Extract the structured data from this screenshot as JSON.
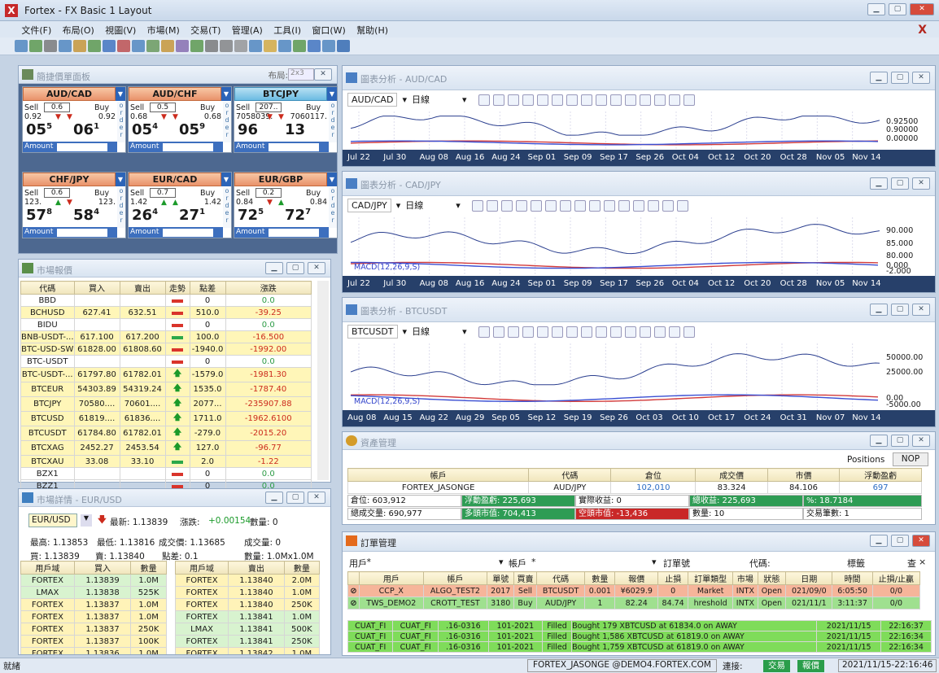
{
  "window": {
    "title": "Fortex - FX Basic 1 Layout"
  },
  "menu": [
    "文件(F)",
    "布局(O)",
    "視圖(V)",
    "市場(M)",
    "交易(T)",
    "管理(A)",
    "工具(I)",
    "窗口(W)",
    "幫助(H)"
  ],
  "quick_trade": {
    "title": "簡捷價單面板",
    "layout_label": "布局:",
    "layout_value": "2x3",
    "tiles": [
      {
        "pair": "AUD/CAD",
        "color": "orange",
        "spread": "0.6",
        "sell_label": "Sell",
        "buy_label": "Buy",
        "sell_small": "0.92",
        "buy_small": "0.92",
        "sell_big": "05",
        "sell_sup": "5",
        "buy_big": "06",
        "buy_sup": "1",
        "dir": "down",
        "amount_label": "Amount"
      },
      {
        "pair": "AUD/CHF",
        "color": "orange",
        "spread": "0.5",
        "sell_label": "Sell",
        "buy_label": "Buy",
        "sell_small": "0.68",
        "buy_small": "0.68",
        "sell_big": "05",
        "sell_sup": "4",
        "buy_big": "05",
        "buy_sup": "9",
        "dir": "down",
        "amount_label": "Amount"
      },
      {
        "pair": "BTCJPY",
        "color": "blue",
        "spread": "207..",
        "sell_label": "Sell",
        "buy_label": "Buy",
        "sell_small": "7058039.",
        "buy_small": "7060117.",
        "sell_big": "96",
        "sell_sup": "",
        "buy_big": "13",
        "buy_sup": "",
        "dir": "down",
        "amount_label": "Amount"
      },
      {
        "pair": "CHF/JPY",
        "color": "orange",
        "spread": "0.6",
        "sell_label": "Sell",
        "buy_label": "Buy",
        "sell_small": "123.",
        "buy_small": "123.",
        "sell_big": "57",
        "sell_sup": "8",
        "buy_big": "58",
        "buy_sup": "4",
        "dir": "updown",
        "amount_label": "Amount"
      },
      {
        "pair": "EUR/CAD",
        "color": "orange",
        "spread": "0.7",
        "sell_label": "Sell",
        "buy_label": "Buy",
        "sell_small": "1.42",
        "buy_small": "1.42",
        "sell_big": "26",
        "sell_sup": "4",
        "buy_big": "27",
        "buy_sup": "1",
        "dir": "up",
        "amount_label": "Amount"
      },
      {
        "pair": "EUR/GBP",
        "color": "orange",
        "spread": "0.2",
        "sell_label": "Sell",
        "buy_label": "Buy",
        "sell_small": "0.84",
        "buy_small": "0.84",
        "sell_big": "72",
        "sell_sup": "5",
        "buy_big": "72",
        "buy_sup": "7",
        "dir": "downup",
        "amount_label": "Amount"
      }
    ],
    "order_label": "order"
  },
  "market_quotes": {
    "title": "市場報價",
    "headers": [
      "代碼",
      "買入",
      "賣出",
      "走勢",
      "點差",
      "漲跌"
    ],
    "rows": [
      {
        "code": "BBD",
        "bid": "",
        "ask": "",
        "trend": "flat",
        "spread": "0",
        "change": "0.0",
        "hl": false
      },
      {
        "code": "BCHUSD",
        "bid": "627.41",
        "ask": "632.51",
        "trend": "flat",
        "spread": "510.0",
        "change": "-39.25",
        "hl": true
      },
      {
        "code": "BIDU",
        "bid": "",
        "ask": "",
        "trend": "flat",
        "spread": "0",
        "change": "0.0",
        "hl": false
      },
      {
        "code": "BNB-USDT-...",
        "bid": "617.100",
        "ask": "617.200",
        "trend": "flatg",
        "spread": "100.0",
        "change": "-16.500",
        "hl": true
      },
      {
        "code": "BTC-USD-SW",
        "bid": "61828.00",
        "ask": "61808.60",
        "trend": "flat",
        "spread": "-1940.0",
        "change": "-1992.00",
        "hl": true
      },
      {
        "code": "BTC-USDT",
        "bid": "",
        "ask": "",
        "trend": "flat",
        "spread": "0",
        "change": "0.0",
        "hl": false
      },
      {
        "code": "BTC-USDT-...",
        "bid": "61797.80",
        "ask": "61782.01",
        "trend": "up",
        "spread": "-1579.0",
        "change": "-1981.30",
        "hl": true
      },
      {
        "code": "BTCEUR",
        "bid": "54303.89",
        "ask": "54319.24",
        "trend": "up",
        "spread": "1535.0",
        "change": "-1787.40",
        "hl": true
      },
      {
        "code": "BTCJPY",
        "bid": "70580....",
        "ask": "70601....",
        "trend": "up",
        "spread": "2077...",
        "change": "-235907.88",
        "hl": true
      },
      {
        "code": "BTCUSD",
        "bid": "61819....",
        "ask": "61836....",
        "trend": "up",
        "spread": "1711.0",
        "change": "-1962.6100",
        "hl": true
      },
      {
        "code": "BTCUSDT",
        "bid": "61784.80",
        "ask": "61782.01",
        "trend": "up",
        "spread": "-279.0",
        "change": "-2015.20",
        "hl": true
      },
      {
        "code": "BTCXAG",
        "bid": "2452.27",
        "ask": "2453.54",
        "trend": "up",
        "spread": "127.0",
        "change": "-96.77",
        "hl": true
      },
      {
        "code": "BTCXAU",
        "bid": "33.08",
        "ask": "33.10",
        "trend": "flatg",
        "spread": "2.0",
        "change": "-1.22",
        "hl": true
      },
      {
        "code": "BZX1",
        "bid": "",
        "ask": "",
        "trend": "flat",
        "spread": "0",
        "change": "0.0",
        "hl": false
      },
      {
        "code": "BZZ1",
        "bid": "",
        "ask": "",
        "trend": "flat",
        "spread": "0",
        "change": "0.0",
        "hl": false
      }
    ]
  },
  "market_detail": {
    "title": "市場詳情 - EUR/USD",
    "symbol": "EUR/USD",
    "last": "最新: 1.13839",
    "change_label": "漲跌:",
    "change": "+0.00154",
    "volume_label": "數量: 0",
    "high": "最高: 1.13853",
    "low": "最低: 1.13816",
    "deal": "成交價: 1.13685",
    "deal_vol": "成交量: 0",
    "buy": "買: 1.13839",
    "sell": "賣: 1.13840",
    "spread": "點差: 0.1",
    "qty": "數量: 1.0Mx1.0M",
    "bid_headers": [
      "用戶域",
      "買入",
      "數量"
    ],
    "ask_headers": [
      "用戶域",
      "賣出",
      "數量"
    ],
    "bids": [
      [
        "FORTEX",
        "1.13839",
        "1.0M"
      ],
      [
        "LMAX",
        "1.13838",
        "525K"
      ],
      [
        "FORTEX",
        "1.13837",
        "1.0M"
      ],
      [
        "FORTEX",
        "1.13837",
        "1.0M"
      ],
      [
        "FORTEX",
        "1.13837",
        "250K"
      ],
      [
        "FORTEX",
        "1.13837",
        "100K"
      ],
      [
        "FORTEX",
        "1.13836",
        "1.0M"
      ]
    ],
    "asks": [
      [
        "FORTEX",
        "1.13840",
        "2.0M"
      ],
      [
        "FORTEX",
        "1.13840",
        "1.0M"
      ],
      [
        "FORTEX",
        "1.13840",
        "250K"
      ],
      [
        "FORTEX",
        "1.13841",
        "1.0M"
      ],
      [
        "LMAX",
        "1.13841",
        "500K"
      ],
      [
        "FORTEX",
        "1.13841",
        "250K"
      ],
      [
        "FORTEX",
        "1.13842",
        "1.0M"
      ]
    ]
  },
  "charts": [
    {
      "title": "圖表分析 - AUD/CAD",
      "symbol": "AUD/CAD",
      "period": "日線",
      "macd": "",
      "xticks": [
        "Jul 22",
        "Jul 30",
        "Aug 08",
        "Aug 16",
        "Aug 24",
        "Sep 01",
        "Sep 09",
        "Sep 17",
        "Sep 26",
        "Oct 04",
        "Oct 12",
        "Oct 20",
        "Oct 28",
        "Nov 05",
        "Nov 14"
      ],
      "yticks": [
        "0.92500",
        "0.90000",
        "0.00000"
      ]
    },
    {
      "title": "圖表分析 - CAD/JPY",
      "symbol": "CAD/JPY",
      "period": "日線",
      "macd": "MACD(12,26,9,S)",
      "xticks": [
        "Jul 22",
        "Jul 30",
        "Aug 08",
        "Aug 16",
        "Aug 24",
        "Sep 01",
        "Sep 09",
        "Sep 17",
        "Sep 26",
        "Oct 04",
        "Oct 12",
        "Oct 20",
        "Oct 28",
        "Nov 05",
        "Nov 14"
      ],
      "yticks": [
        "90.000",
        "85.000",
        "80.000",
        "0.000",
        "-2.000"
      ]
    },
    {
      "title": "圖表分析 - BTCUSDT",
      "symbol": "BTCUSDT",
      "period": "日線",
      "macd": "MACD(12,26,9,S)",
      "xticks": [
        "Aug 08",
        "Aug 15",
        "Aug 22",
        "Aug 29",
        "Sep 05",
        "Sep 12",
        "Sep 19",
        "Sep 26",
        "Oct 03",
        "Oct 10",
        "Oct 17",
        "Oct 24",
        "Oct 31",
        "Nov 07",
        "Nov 14"
      ],
      "yticks": [
        "50000.00",
        "25000.00",
        "0.00",
        "-5000.00"
      ]
    }
  ],
  "assets": {
    "title": "資產管理",
    "tabs": [
      "Positions",
      "NOP"
    ],
    "headers": [
      "帳戶",
      "代碼",
      "倉位",
      "成交價",
      "市價",
      "浮動盈虧"
    ],
    "row": [
      "FORTEX_JASONGE",
      "AUD/JPY",
      "102,010",
      "83.324",
      "84.106",
      "697"
    ],
    "s1": [
      "倉位: 603,912",
      "浮動盈虧: 225,693",
      "實際收益: 0",
      "總收益: 225,693",
      "%: 18.7184"
    ],
    "s2": [
      "總成交量: 690,977",
      "多頭市值: 704,413",
      "空頭市值: -13,436",
      "數量: 10",
      "交易筆數: 1"
    ]
  },
  "orders": {
    "title": "訂單管理",
    "filters": {
      "user": "用戶",
      "account": "帳戶",
      "order_no": "訂單號",
      "code": "代碼:",
      "tag": "標籤",
      "search": "查"
    },
    "headers": [
      "用戶",
      "帳戶",
      "單號",
      "買賣",
      "代碼",
      "數量",
      "報價",
      "止損",
      "訂單類型",
      "市場",
      "狀態",
      "日期",
      "時間",
      "止損/止贏"
    ],
    "rows": [
      [
        "CCP_X",
        "ALGO_TEST2",
        "2017",
        "Sell",
        "BTCUSDT",
        "0.001",
        "¥6029.9",
        "0",
        "Market",
        "INTX",
        "Open",
        "021/09/0",
        "6:05:50",
        "0/0"
      ],
      [
        "TWS_DEMO2",
        "CROTT_TEST",
        "3180",
        "Buy",
        "AUD/JPY",
        "1",
        "82.24",
        "84.74",
        "hreshold",
        "INTX",
        "Open",
        "021/11/1",
        "3:11:37",
        "0/0"
      ]
    ],
    "log": [
      [
        "CUAT_FI",
        "CUAT_FI",
        ".16-0316",
        "101-2021",
        "Filled",
        "Bought 179 XBTCUSD at 61834.0 on AWAY",
        "2021/11/15",
        "22:16:37"
      ],
      [
        "CUAT_FI",
        "CUAT_FI",
        ".16-0316",
        "101-2021",
        "Filled",
        "Bought 1,586 XBTCUSD at 61819.0 on AWAY",
        "2021/11/15",
        "22:16:34"
      ],
      [
        "CUAT_FI",
        "CUAT_FI",
        ".16-0316",
        "101-2021",
        "Filled",
        "Bought 1,759 XBTCUSD at 61819.0 on AWAY",
        "2021/11/15",
        "22:16:34"
      ]
    ]
  },
  "status": {
    "ready": "就緒",
    "server": "FORTEX_JASONGE @DEMO4.FORTEX.COM",
    "conn": "連接:",
    "trade": "交易",
    "quote": "報價",
    "time": "2021/11/15-22:16:46"
  }
}
